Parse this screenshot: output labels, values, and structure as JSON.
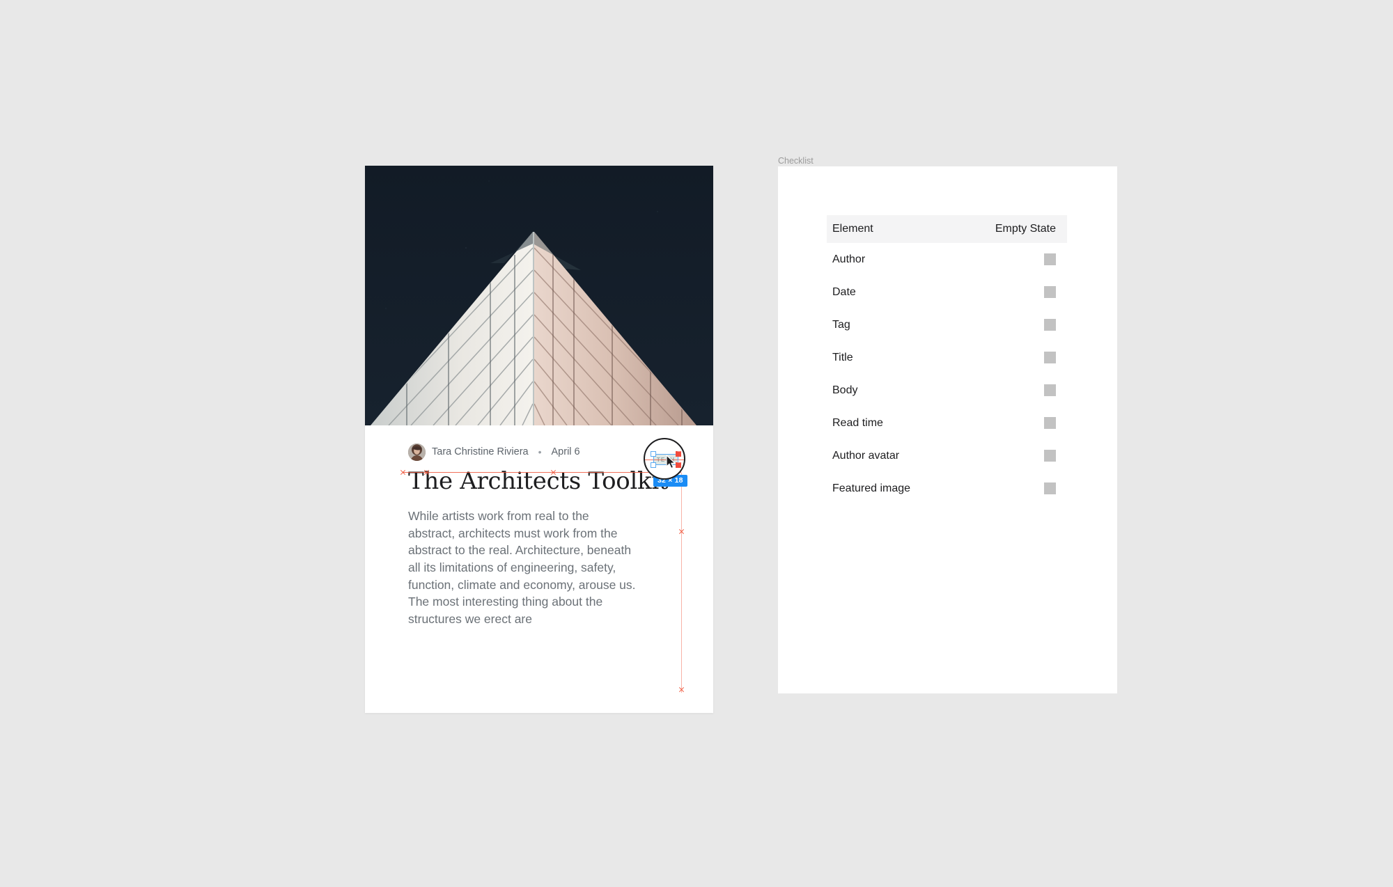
{
  "canvas": {
    "background": "#e8e8e8"
  },
  "article": {
    "hero": {
      "icon": "building-corner-photo",
      "sky_color": "#151f2b",
      "facade_light": "#f0ece6",
      "facade_warm": "#d8c0b4"
    },
    "byline": {
      "avatar_icon": "author-avatar-photo",
      "author": "Tara Christine Riviera",
      "separator": "•",
      "date": "April 6"
    },
    "title": "The Architects Toolkit",
    "body": "While artists work from real to the abstract, architects must work from the abstract to the real. Architecture, beneath all its limitations of engineering, safety, function, climate and economy, arouse us. The most interesting thing about the structures we erect are"
  },
  "selection": {
    "tag_label": "TECH",
    "size_badge": "32 × 18",
    "handle_color": "#5aa9f0",
    "badge_color": "#1b8cf5",
    "guide_color": "#f0573c",
    "cursor_icon": "arrow-cursor",
    "loupe_icon": "magnifier-loupe"
  },
  "checklist": {
    "frame_label": "Checklist",
    "columns": [
      "Element",
      "Empty State"
    ],
    "rows": [
      {
        "label": "Author",
        "state": "empty"
      },
      {
        "label": "Date",
        "state": "empty"
      },
      {
        "label": "Tag",
        "state": "empty"
      },
      {
        "label": "Title",
        "state": "empty"
      },
      {
        "label": "Body",
        "state": "empty"
      },
      {
        "label": "Read time",
        "state": "empty"
      },
      {
        "label": "Author avatar",
        "state": "empty"
      },
      {
        "label": "Featured image",
        "state": "empty"
      }
    ],
    "swatch_color": "#c2c2c2",
    "header_background": "#f4f4f5"
  }
}
